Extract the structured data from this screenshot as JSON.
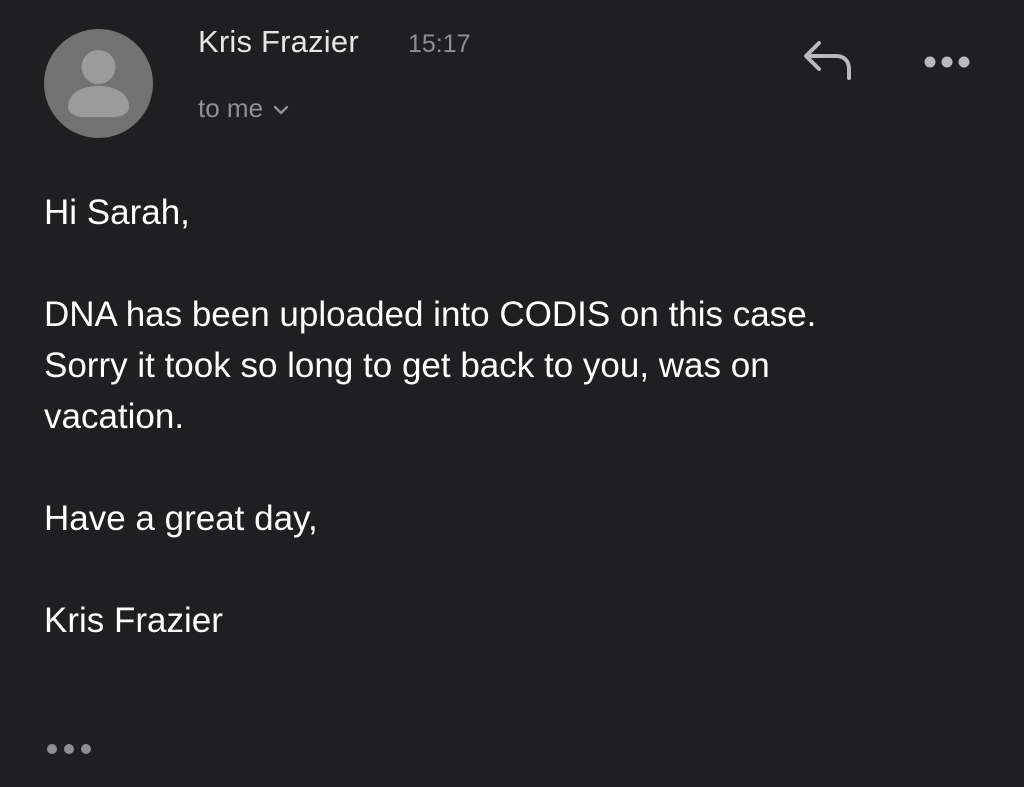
{
  "header": {
    "sender_name": "Kris Frazier",
    "time": "15:17",
    "recipient_label": "to me",
    "avatar_icon": "person-icon",
    "reply_icon": "reply-arrow-icon",
    "more_icon": "more-horizontal-icon"
  },
  "message": {
    "greeting": "Hi Sarah,",
    "body_lines": [
      "DNA has been uploaded into CODIS on this case.",
      "Sorry it took so long to get back to you, was on",
      "vacation."
    ],
    "closing": "Have a great day,",
    "signature": "Kris Frazier"
  },
  "footer": {
    "trimmed_content_icon": "ellipsis-icon"
  },
  "colors": {
    "background": "#1f1f21",
    "avatar": "#727272",
    "avatar_figure": "#9b9b9b",
    "secondary_text": "#8e8e93",
    "icon": "#b9b9bd",
    "text": "#ffffff"
  }
}
